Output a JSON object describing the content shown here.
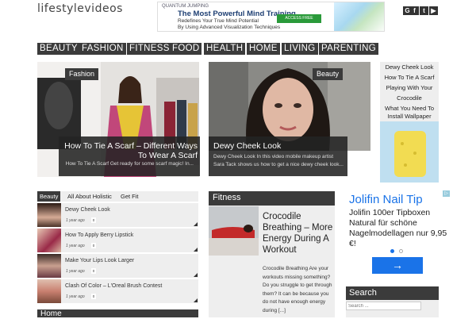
{
  "header": {
    "logo": "lifestylevideos",
    "social": [
      "G",
      "f",
      "t",
      "▶"
    ]
  },
  "ad_top": {
    "brand": "QUANTUM JUMPING",
    "headline": "The Most Powerful Mind Training",
    "line1": "Redefines Your True Mind Potential",
    "line2": "By Using Advanced Visualization Techniques",
    "button": "ACCESS FREE COURSE"
  },
  "nav": [
    "BEAUTY",
    "FASHION",
    "FITNESS",
    "FOOD",
    "HEALTH",
    "HOME",
    "LIVING",
    "PARENTING"
  ],
  "featured": [
    {
      "tag": "Fashion",
      "title": "How To Tie A Scarf – Different Ways To Wear A Scarf",
      "excerpt": "How To Tie A Scarf Get ready for some scarf magic! In..."
    },
    {
      "tag": "Beauty",
      "title": "Dewy Cheek Look",
      "excerpt": "Dewy Cheek Look In this video mobile makeup artist Sara Tack shows us how to get a nice dewy cheek look..."
    }
  ],
  "side_list": [
    "Dewy Cheek Look",
    "How To Tie A Scarf",
    "Playing With Your",
    "Crocodile",
    "What You Need To",
    "Install Wallpaper"
  ],
  "tabs": [
    "Beauty",
    "All About Holistic",
    "Get Fit"
  ],
  "list_items": [
    {
      "title": "Dewy Cheek Look",
      "date": "1 year ago",
      "count": "0"
    },
    {
      "title": "How To Apply Berry Lipstick",
      "date": "1 year ago",
      "count": "0"
    },
    {
      "title": "Make Your Lips Look Larger",
      "date": "1 year ago",
      "count": "0"
    },
    {
      "title": "Clash Of Color – L'Oreal Brush Contest",
      "date": "1 year ago",
      "count": "0"
    }
  ],
  "home_label": "Home",
  "fitness": {
    "label": "Fitness",
    "title": "Crocodile Breathing – More Energy During A Workout",
    "excerpt": "Crocodile Breathing Are your workouts missing something?  Do you struggle to get through them? It can be because you do not have enough energy during [...]"
  },
  "ad_side": {
    "headline": "Jolifin Nail Tip",
    "text": "Jolifin 100er Tipboxen Natural für schöne Nagelmodellagen nur 9,95 €!",
    "button_icon": "arrow-right-icon"
  },
  "search": {
    "label": "Search",
    "placeholder": "Search ..."
  },
  "colors": {
    "dark": "#3b3b3b",
    "ad_blue": "#1a73e8",
    "headline_blue": "#1e3f73"
  }
}
